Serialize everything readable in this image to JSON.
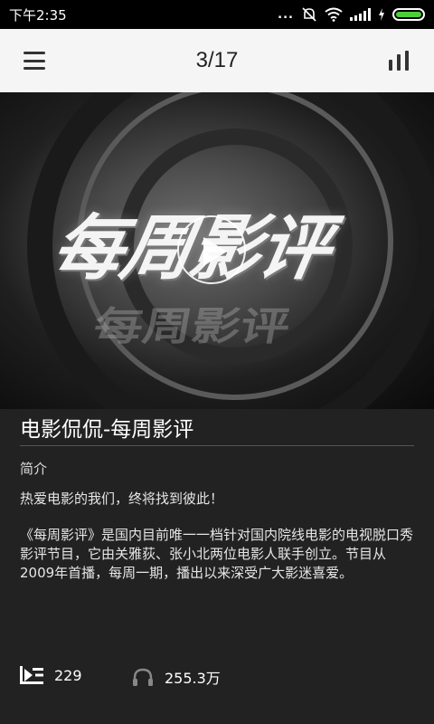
{
  "status_bar": {
    "time": "下午2:35",
    "dots": "...",
    "battery_color": "#4ccf3a",
    "icons": [
      "mute-icon",
      "wifi-icon",
      "signal-icon",
      "charging-icon",
      "battery-icon"
    ]
  },
  "header": {
    "title": "3/17",
    "left_icon": "menu-icon",
    "right_icon": "bars-icon"
  },
  "cover": {
    "text": "每周影评",
    "play_icon": "play-icon"
  },
  "program": {
    "title": "电影侃侃-每周影评",
    "section_label": "简介",
    "tagline": "热爱电影的我们，终将找到彼此！",
    "description": "《每周影评》是国内目前唯一一档针对国内院线电影的电视脱口秀影评节目，它由关雅荻、张小北两位电影人联手创立。节目从2009年首播，每周一期，播出以来深受广大影迷喜爱。"
  },
  "stats": {
    "episodes": "229",
    "episodes_icon": "playlist-icon",
    "plays": "255.3万",
    "plays_icon": "headphones-icon"
  }
}
